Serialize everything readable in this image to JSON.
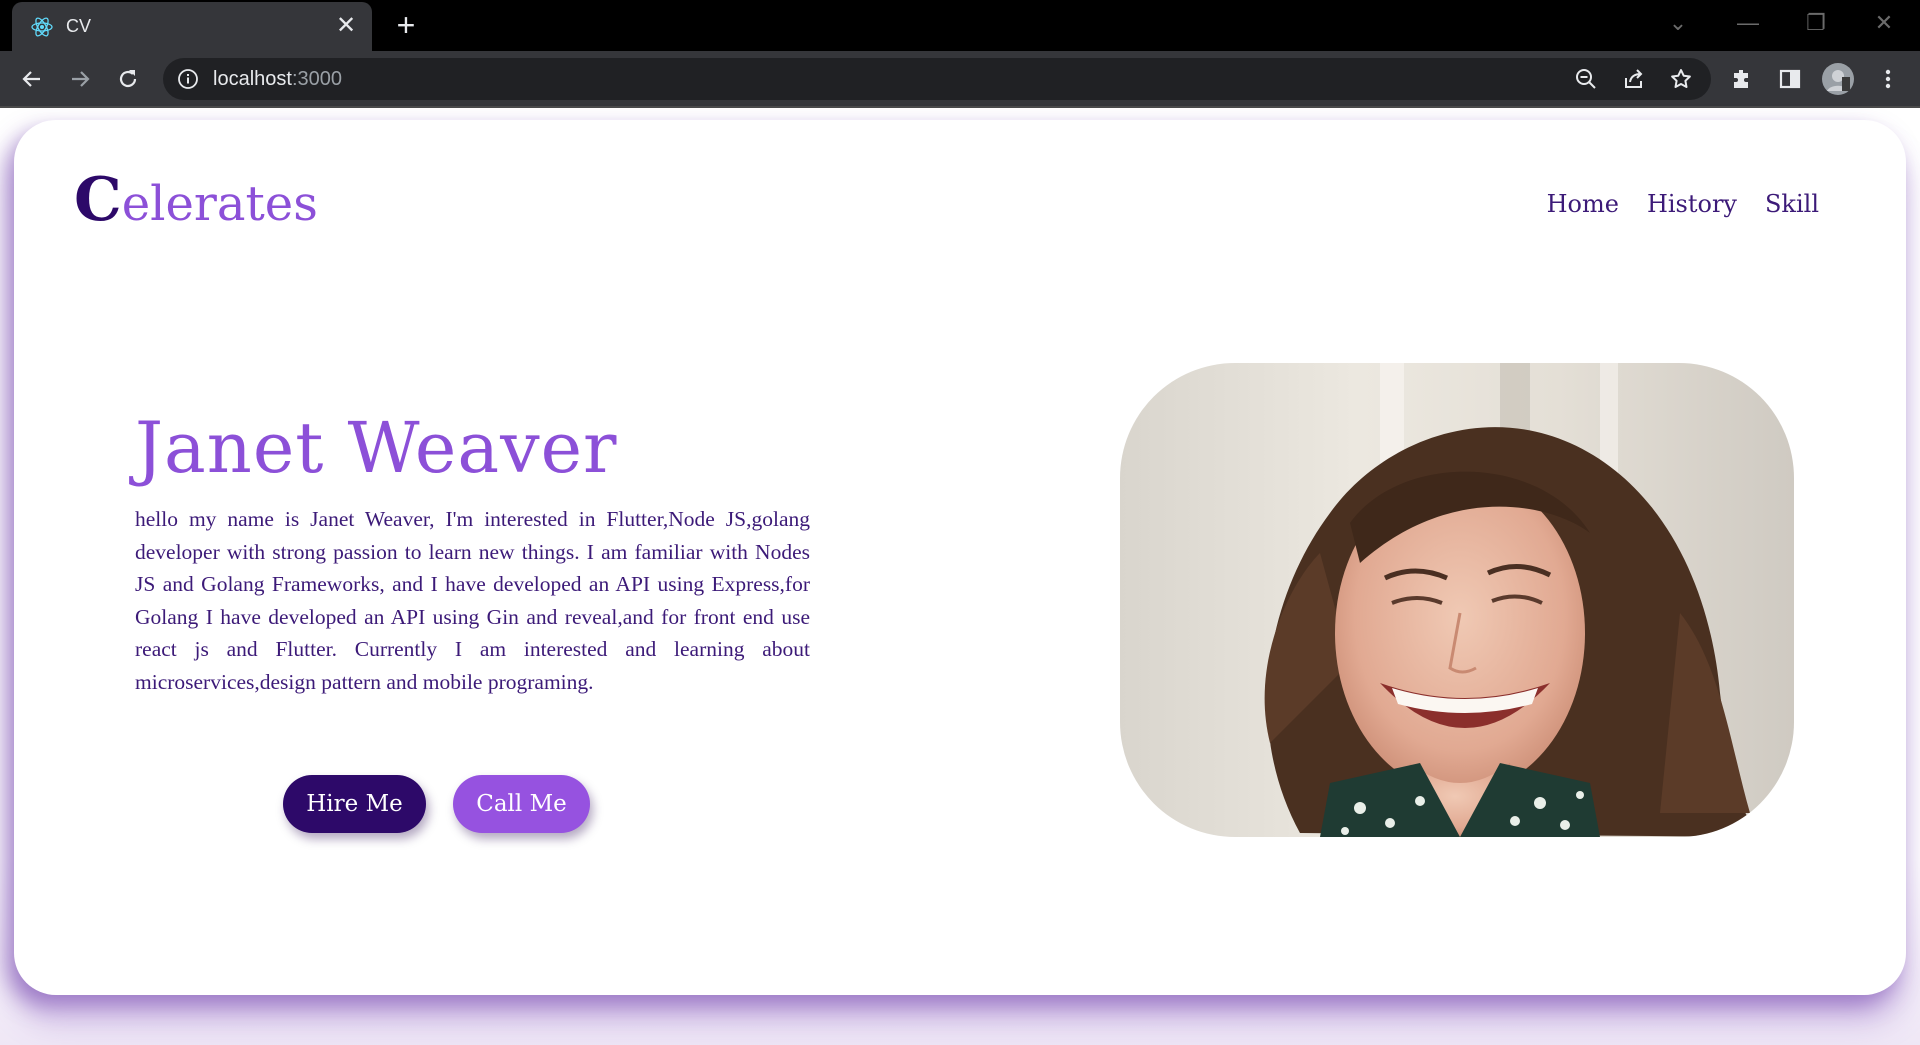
{
  "browser": {
    "tab_title": "CV",
    "tab_close_glyph": "✕",
    "new_tab_glyph": "+",
    "url_host": "localhost",
    "url_port": ":3000",
    "window_controls": [
      "⌄",
      "—",
      "❐",
      "✕"
    ]
  },
  "header": {
    "logo_initial": "C",
    "logo_rest": "elerates",
    "nav": [
      "Home",
      "History",
      "Skill"
    ]
  },
  "hero": {
    "name": "Janet Weaver",
    "bio": "hello my name is Janet Weaver, I'm interested in Flutter,Node JS,golang developer with strong passion to learn new things. I am familiar with Nodes JS and Golang Frameworks, and I have developed an API using Express,for Golang I have developed an API using Gin and reveal,and for front end use react js and Flutter. Currently I am interested and learning about microservices,design pattern and mobile programing.",
    "buttons": {
      "hire": "Hire Me",
      "call": "Call Me"
    }
  },
  "colors": {
    "accent": "#8c50d8",
    "dark_purple": "#2d0969",
    "text_purple": "#3c1a78",
    "call_button": "#9652e0"
  },
  "icons": [
    "react-favicon-icon",
    "back-arrow-icon",
    "forward-arrow-icon",
    "reload-icon",
    "info-icon",
    "zoom-out-icon",
    "share-icon",
    "star-icon",
    "extensions-icon",
    "side-panel-icon",
    "profile-avatar",
    "more-menu-icon"
  ]
}
